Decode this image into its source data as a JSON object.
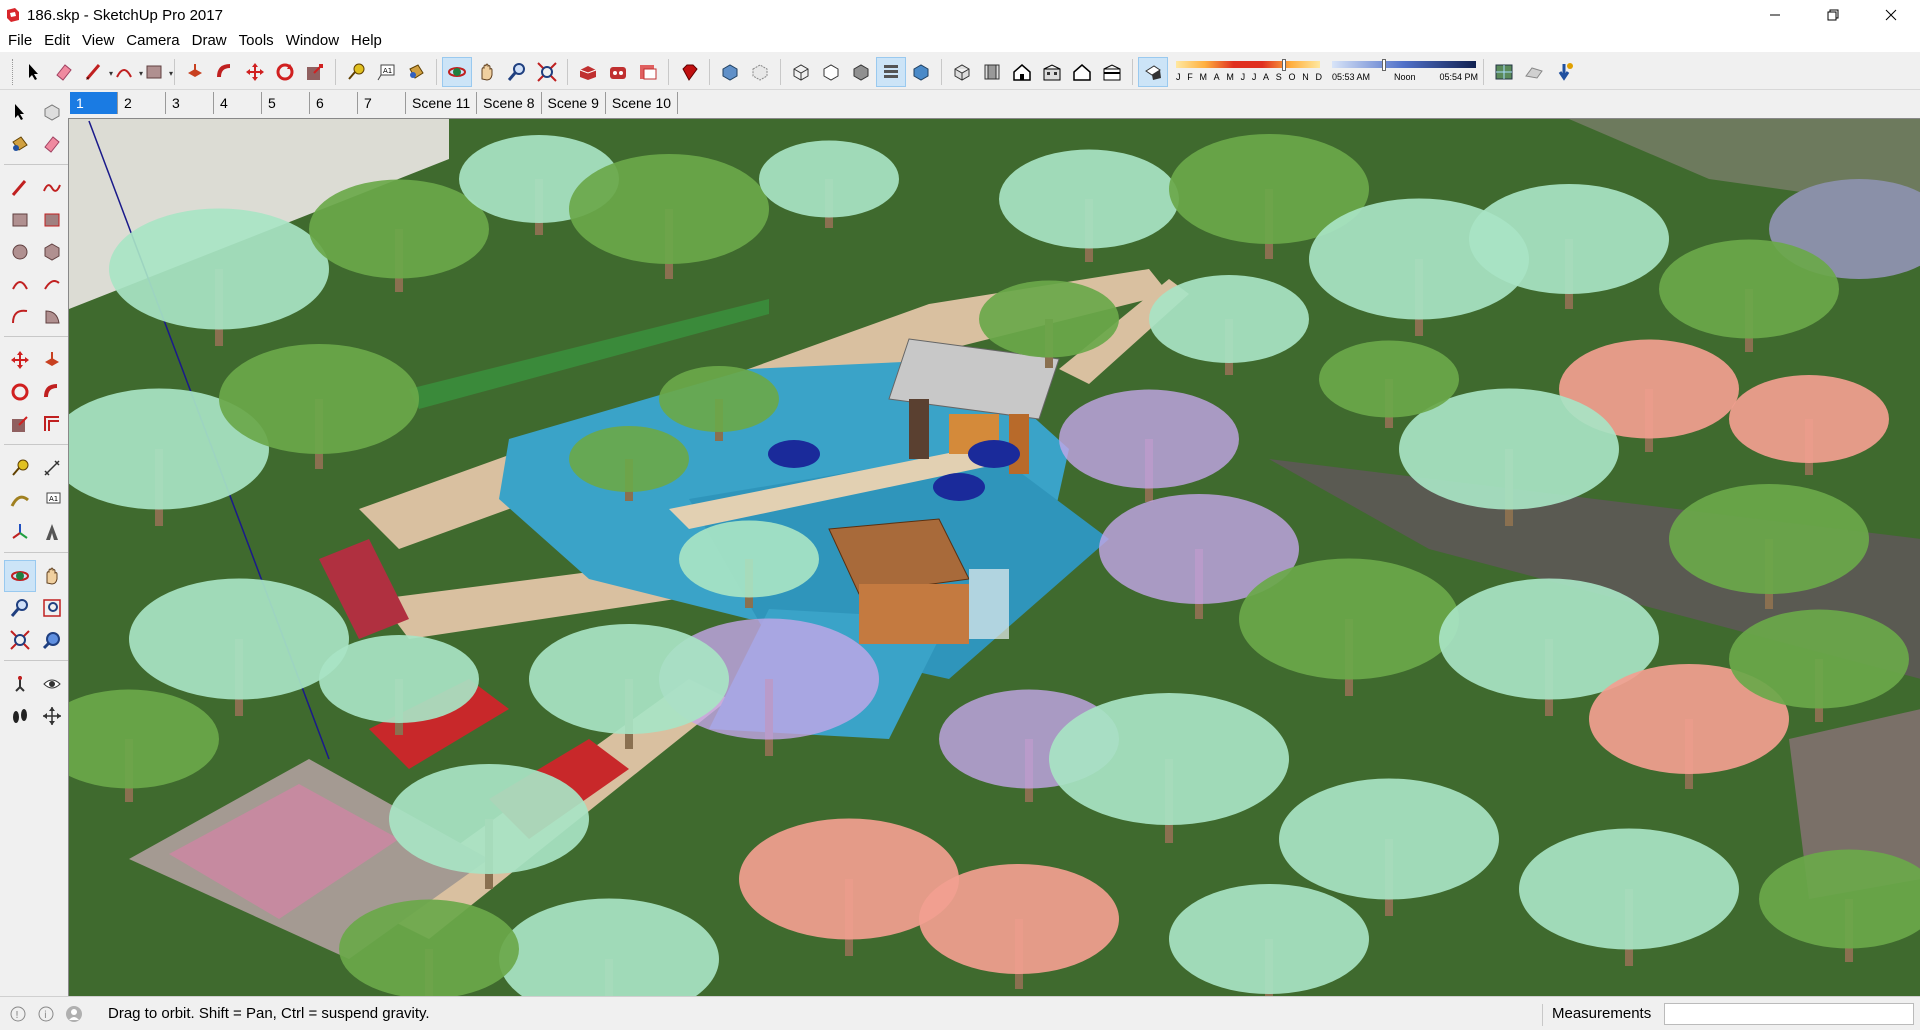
{
  "window": {
    "title": "186.skp - SketchUp Pro 2017",
    "controls": [
      "minimize",
      "maximize",
      "close"
    ]
  },
  "menu": [
    "File",
    "Edit",
    "View",
    "Camera",
    "Draw",
    "Tools",
    "Window",
    "Help"
  ],
  "toolbar_top": {
    "groups": [
      [
        "select-icon",
        "eraser-icon",
        "line-icon",
        "arc-icon",
        "rectangle-icon"
      ],
      [
        "pushpull-icon",
        "followme-icon",
        "move-icon",
        "rotate-icon",
        "scale-icon"
      ],
      [
        "tape-icon",
        "text-icon",
        "paint-icon"
      ],
      [
        "orbit-icon",
        "pan-icon",
        "zoom-icon",
        "zoom-extents-icon"
      ],
      [
        "3d-warehouse-icon",
        "extension-warehouse-icon",
        "layout-icon"
      ],
      [
        "ruby-icon"
      ],
      [
        "xray-icon",
        "back-edges-icon"
      ],
      [
        "wireframe-icon",
        "hidden-line-icon",
        "shaded-icon",
        "shaded-textures-icon",
        "monochrome-icon"
      ],
      [
        "iso-view-icon",
        "top-view-icon",
        "front-view-icon",
        "right-view-icon",
        "back-view-icon",
        "left-view-icon"
      ],
      [
        "shadows-icon"
      ]
    ]
  },
  "shadow_settings": {
    "months": [
      "J",
      "F",
      "M",
      "A",
      "M",
      "J",
      "J",
      "A",
      "S",
      "O",
      "N",
      "D"
    ],
    "time_start": "05:53 AM",
    "time_mid": "Noon",
    "time_end": "05:54 PM"
  },
  "scenes": [
    "1",
    "2",
    "3",
    "4",
    "5",
    "6",
    "7",
    "Scene 11",
    "Scene 8",
    "Scene 9",
    "Scene 10"
  ],
  "active_scene": "1",
  "toolbar_left": [
    "select-icon",
    "make-component-icon",
    "paint-bucket-icon",
    "eraser-icon",
    "line-icon",
    "freehand-icon",
    "rectangle-icon",
    "rotated-rectangle-icon",
    "circle-icon",
    "polygon-icon",
    "arc-icon",
    "two-point-arc-icon",
    "three-point-arc-icon",
    "pie-icon",
    "move-icon",
    "pushpull-icon",
    "rotate-icon",
    "followme-icon",
    "scale-icon",
    "offset-icon",
    "tape-icon",
    "dimension-icon",
    "protractor-icon",
    "text-icon",
    "axes-icon",
    "3d-text-icon",
    "orbit-icon",
    "pan-icon",
    "zoom-icon",
    "zoom-window-icon",
    "zoom-extents-icon",
    "previous-view-icon",
    "position-camera-icon",
    "look-around-icon",
    "walk-icon",
    "section-plane-icon"
  ],
  "status": {
    "message": "Drag to orbit. Shift = Pan, Ctrl = suspend gravity.",
    "measurements_label": "Measurements",
    "measurements_value": ""
  },
  "colors": {
    "accent": "#1a7be3",
    "ground": "#3f6a2e",
    "water": "#3aa3c8",
    "tree_mint": "#a8e4c4",
    "tree_green": "#6aa84a",
    "tree_pink": "#f2a090",
    "tree_lavender": "#c4a6e8",
    "path": "#d9c0a0"
  }
}
